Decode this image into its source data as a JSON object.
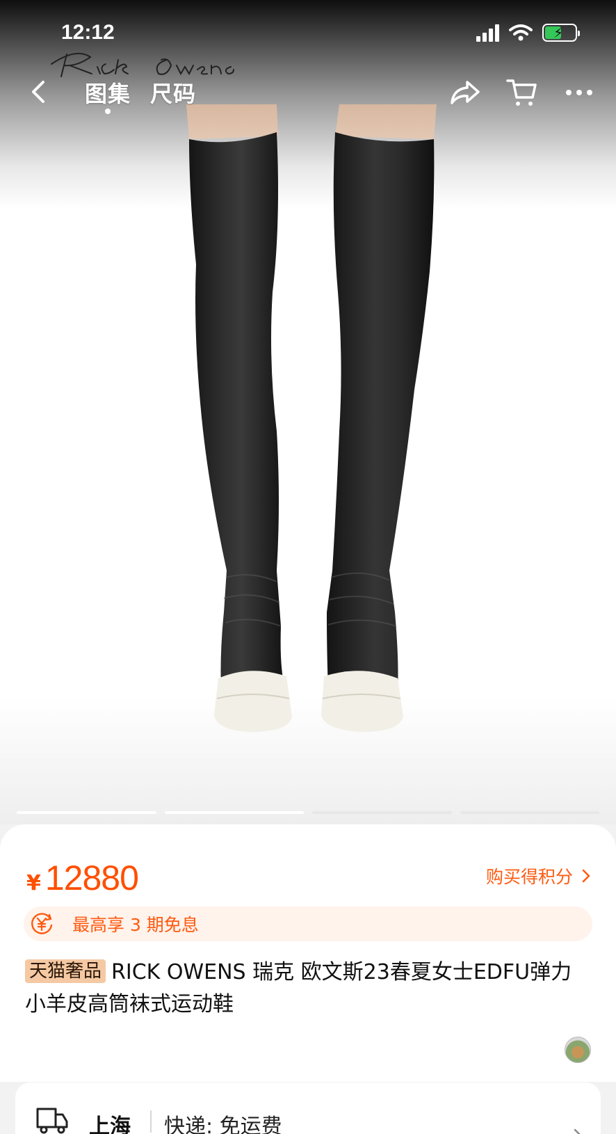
{
  "status_bar": {
    "time": "12:12"
  },
  "brand_logo_text": "Rick Owens",
  "nav": {
    "tabs": [
      {
        "label": "图集",
        "active": true
      },
      {
        "label": "尺码",
        "active": false
      }
    ],
    "icons": [
      "back-chevron-icon",
      "share-icon",
      "cart-icon",
      "more-icon"
    ]
  },
  "gallery": {
    "current_image": 2,
    "total_images": 4
  },
  "product": {
    "currency": "¥",
    "price": "12880",
    "points_link": "购买得积分",
    "installment": "最高享 3 期免息",
    "tag": "天猫奢品",
    "title": "RICK OWENS 瑞克 欧文斯23春夏女士EDFU弹力小羊皮高筒袜式运动鞋"
  },
  "shipping": {
    "city": "上海",
    "text": "快递: 免运费"
  },
  "colors": {
    "accent": "#ff5a10",
    "price": "#ff4f00",
    "tag_bg": "#f4c9a3",
    "installment_bg": "#fff3ec"
  }
}
